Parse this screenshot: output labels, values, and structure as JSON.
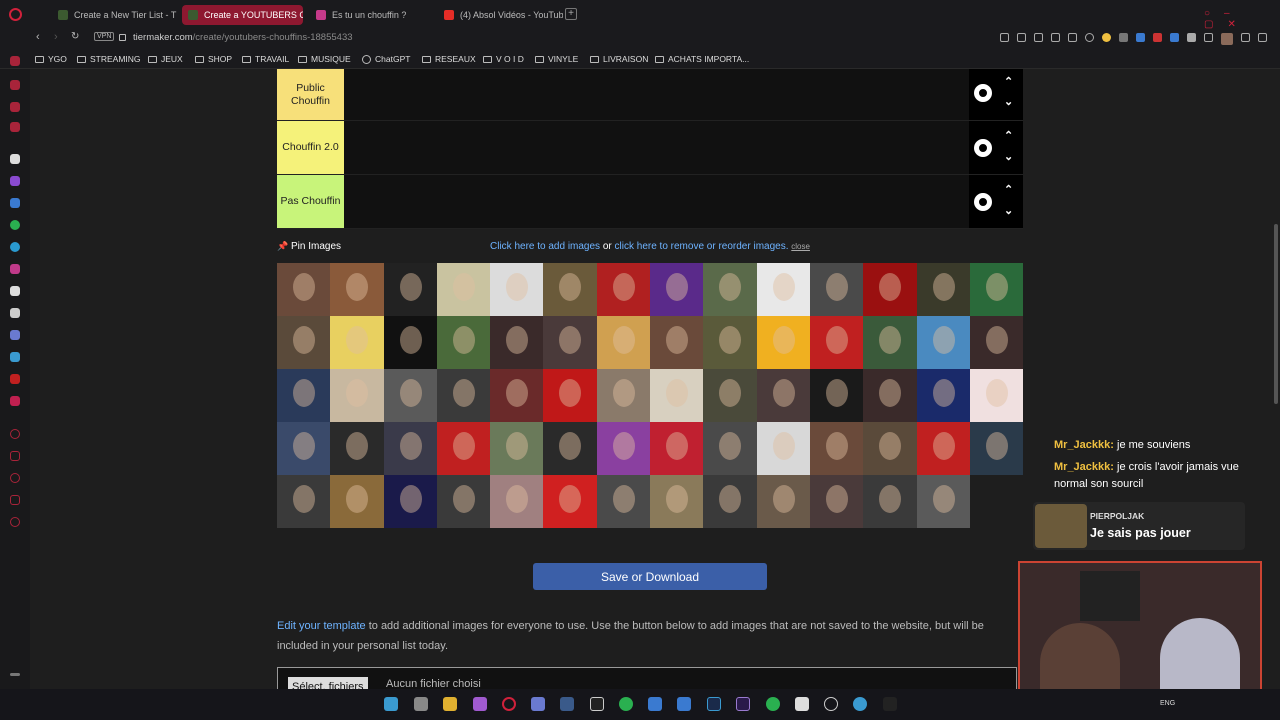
{
  "browser": {
    "tabs": [
      {
        "title": "Create a New Tier List - T",
        "favicon_color": "#3c5a30",
        "active": false
      },
      {
        "title": "Create a YOUTUBERS CH",
        "favicon_color": "#3c5a30",
        "active": true
      },
      {
        "title": "Es tu un chouffin ?",
        "favicon_color": "#c63a8a",
        "active": false
      },
      {
        "title": "(4) Absol Vidéos - YouTub",
        "favicon_color": "#e52d27",
        "active": false
      }
    ],
    "url_host": "tiermaker.com",
    "url_path": "/create/youtubers-chouffins-18855433",
    "vpn_badge": "VPN",
    "bookmarks": [
      "YGO",
      "STREAMING",
      "JEUX",
      "SHOP",
      "TRAVAIL",
      "MUSIQUE",
      "ChatGPT",
      "RESEAUX",
      "V O I D",
      "VINYLE",
      "LIVRAISON",
      "ACHATS IMPORTA..."
    ]
  },
  "tiers": [
    {
      "label": "Public Chouffin",
      "color": "#f7e07a"
    },
    {
      "label": "Chouffin 2.0",
      "color": "#f5f27a"
    },
    {
      "label": "Pas Chouffin",
      "color": "#c8f47a"
    }
  ],
  "pin": {
    "label": "Pin Images",
    "add_link": "Click here to add images",
    "or": "or",
    "remove_link": "click here to remove or reorder images.",
    "close": "close"
  },
  "image_tiles": [
    "#6a4a3a",
    "#8a5a3a",
    "#222222",
    "#c9c3a0",
    "#dcdcdc",
    "#6a5a3a",
    "#b02020",
    "#5a2a8a",
    "#5a6a4a",
    "#e8e8e8",
    "#4a4a4a",
    "#9a1010",
    "#3a3a2a",
    "#2a6a3a",
    "#5a4a3a",
    "#e8d060",
    "#111111",
    "#4a6a3a",
    "#3a2a2a",
    "#4a3a3a",
    "#d0a050",
    "#6a4a3a",
    "#5a5a3a",
    "#f0b020",
    "#c02020",
    "#3a5a3a",
    "#4a8ac0",
    "#3a2a2a",
    "#2a3a5a",
    "#c8b8a0",
    "#5a5a5a",
    "#3a3a3a",
    "#6a2a2a",
    "#c01818",
    "#8a7a6a",
    "#d8d0c0",
    "#4a4a3a",
    "#4a3a3a",
    "#1a1a1a",
    "#3a2a2a",
    "#1a2a6a",
    "#f0e0e0",
    "#3a4a6a",
    "#2a2a2a",
    "#3a3a4a",
    "#c02020",
    "#6a7a5a",
    "#2a2a2a",
    "#8a40a0",
    "#c02030",
    "#4a4a4a",
    "#d8d8d8",
    "#6a4a3a",
    "#5a4a3a",
    "#c02020",
    "#2a3a4a",
    "#3a3a3a",
    "#8a6a3a",
    "#1a1a4a",
    "#3a3a3a",
    "#a08080",
    "#d02020",
    "#4a4a4a",
    "#8a7a5a",
    "#3a3a3a",
    "#6a5a4a",
    "#4a3a3a",
    "#3a3a3a",
    "#5a5a5a"
  ],
  "save_button": "Save or Download",
  "edit_link": "Edit your template",
  "paragraph_rest": " to add additional images for everyone to use. Use the button below to add images that are not saved to the website, but will be included in your personal list today.",
  "file_button": "Sélect. fichiers",
  "file_status": "Aucun fichier choisi",
  "overlay": {
    "chat": [
      {
        "user": "Mr_Jackkk:",
        "msg": "je me souviens"
      },
      {
        "user": "Mr_Jackkk:",
        "msg": "je crois l'avoir jamais vue normal son sourcil"
      }
    ],
    "alert_name": "PIERPOLJAK",
    "alert_msg": "Je sais pas jouer"
  },
  "taskbar": {
    "lang": "ENG"
  }
}
